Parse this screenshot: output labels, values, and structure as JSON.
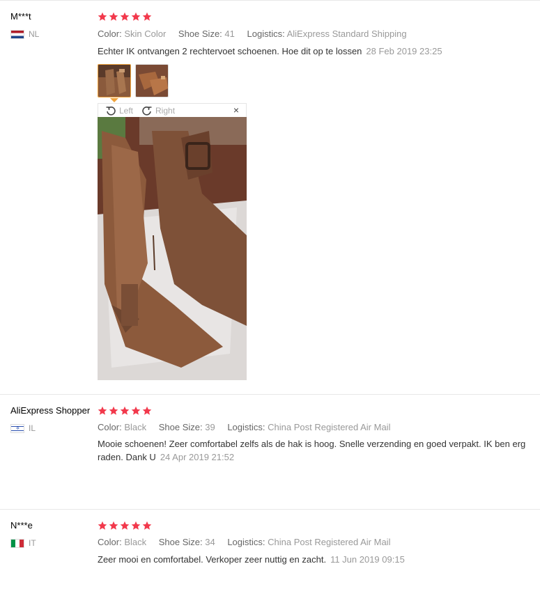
{
  "colors": {
    "star": "#f2394c",
    "thumb_active_border": "#f0a33b"
  },
  "reviews": [
    {
      "user": "M***t",
      "country": "NL",
      "flag_icon": "flag-nl-icon",
      "rating": 5,
      "color_label": "Color:",
      "color_value": "Skin Color",
      "size_label": "Shoe Size:",
      "size_value": "41",
      "logistics_label": "Logistics:",
      "logistics_value": "AliExpress Standard Shipping",
      "text": "Echter IK ontvangen 2 rechtervoet schoenen. Hoe dit op te lossen",
      "date": "28 Feb 2019 23:25"
    },
    {
      "user": "AliExpress Shopper",
      "country": "IL",
      "flag_icon": "flag-il-icon",
      "rating": 5,
      "color_label": "Color:",
      "color_value": "Black",
      "size_label": "Shoe Size:",
      "size_value": "39",
      "logistics_label": "Logistics:",
      "logistics_value": "China Post Registered Air Mail",
      "text_line1": "Mooie schoenen! Zeer comfortabel zelfs als de hak is hoog. Snelle verzending en goed verpakt. IK ben erg",
      "text_line2": "raden. Dank U",
      "date": "24 Apr 2019 21:52"
    },
    {
      "user": "N***e",
      "country": "IT",
      "flag_icon": "flag-it-icon",
      "rating": 5,
      "color_label": "Color:",
      "color_value": "Black",
      "size_label": "Shoe Size:",
      "size_value": "34",
      "logistics_label": "Logistics:",
      "logistics_value": "China Post Registered Air Mail",
      "text": "Zeer mooi en comfortabel. Verkoper zeer nuttig en zacht.",
      "date": "11 Jun 2019 09:15"
    }
  ],
  "viewer": {
    "rotate_left": "Left",
    "rotate_right": "Right",
    "close": "×"
  }
}
